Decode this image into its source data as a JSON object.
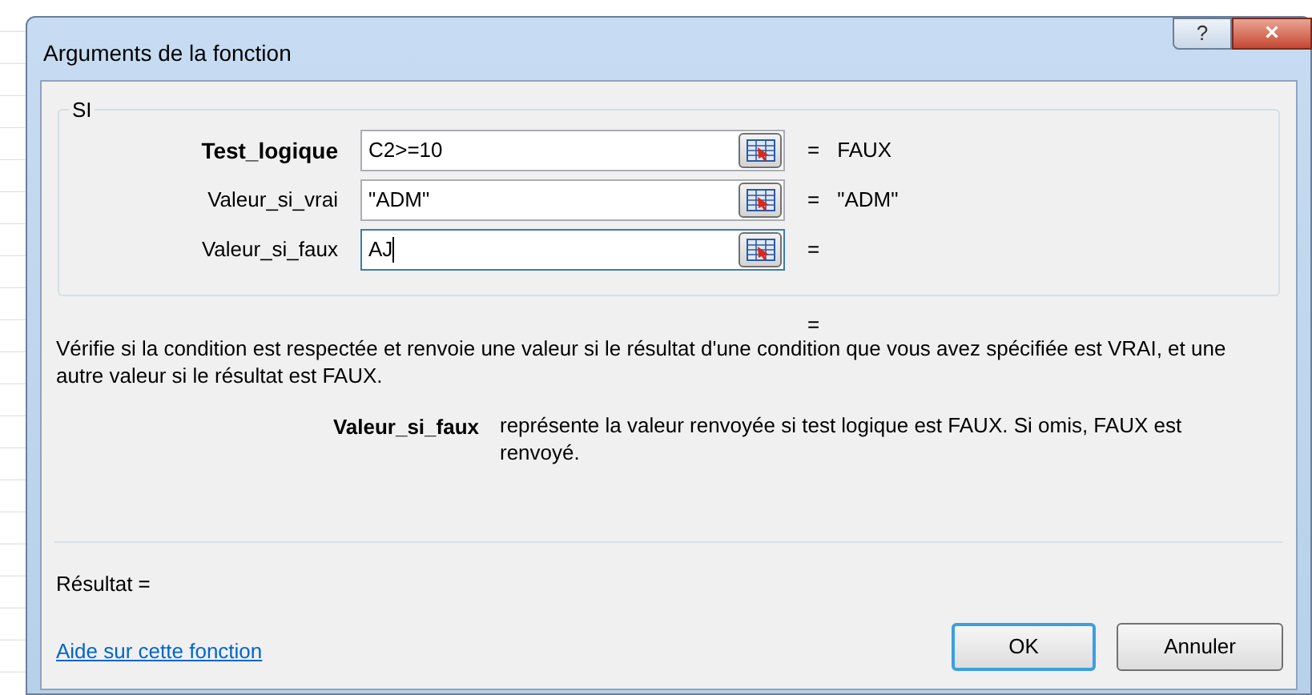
{
  "window": {
    "title": "Arguments de la fonction",
    "buttons": [
      "?",
      "×"
    ]
  },
  "function_group": {
    "name": "SI",
    "arguments": [
      {
        "label": "Test_logique",
        "required": true,
        "value": "C2>=10",
        "focused": false,
        "equals": "=",
        "result": "FAUX"
      },
      {
        "label": "Valeur_si_vrai",
        "required": false,
        "value": "\"ADM\"",
        "focused": false,
        "equals": "=",
        "result": "\"ADM\""
      },
      {
        "label": "Valeur_si_faux",
        "required": false,
        "value": "AJ",
        "focused": true,
        "equals": "="
      }
    ]
  },
  "function_result": "=",
  "description": "Vérifie si la condition est respectée et renvoie une valeur si le résultat d'une condition que vous avez spécifiée est VRAI, et une autre valeur si le résultat est FAUX.",
  "argument_help": {
    "name": "Valeur_si_faux",
    "text": "représente la valeur renvoyée si test logique est FAUX. Si omis, FAUX est renvoyé."
  },
  "result_label": "Résultat =",
  "help_link": "Aide sur cette fonction",
  "buttons": [
    {
      "label": "OK",
      "default": true
    },
    {
      "label": "Annuler",
      "default": false
    }
  ]
}
